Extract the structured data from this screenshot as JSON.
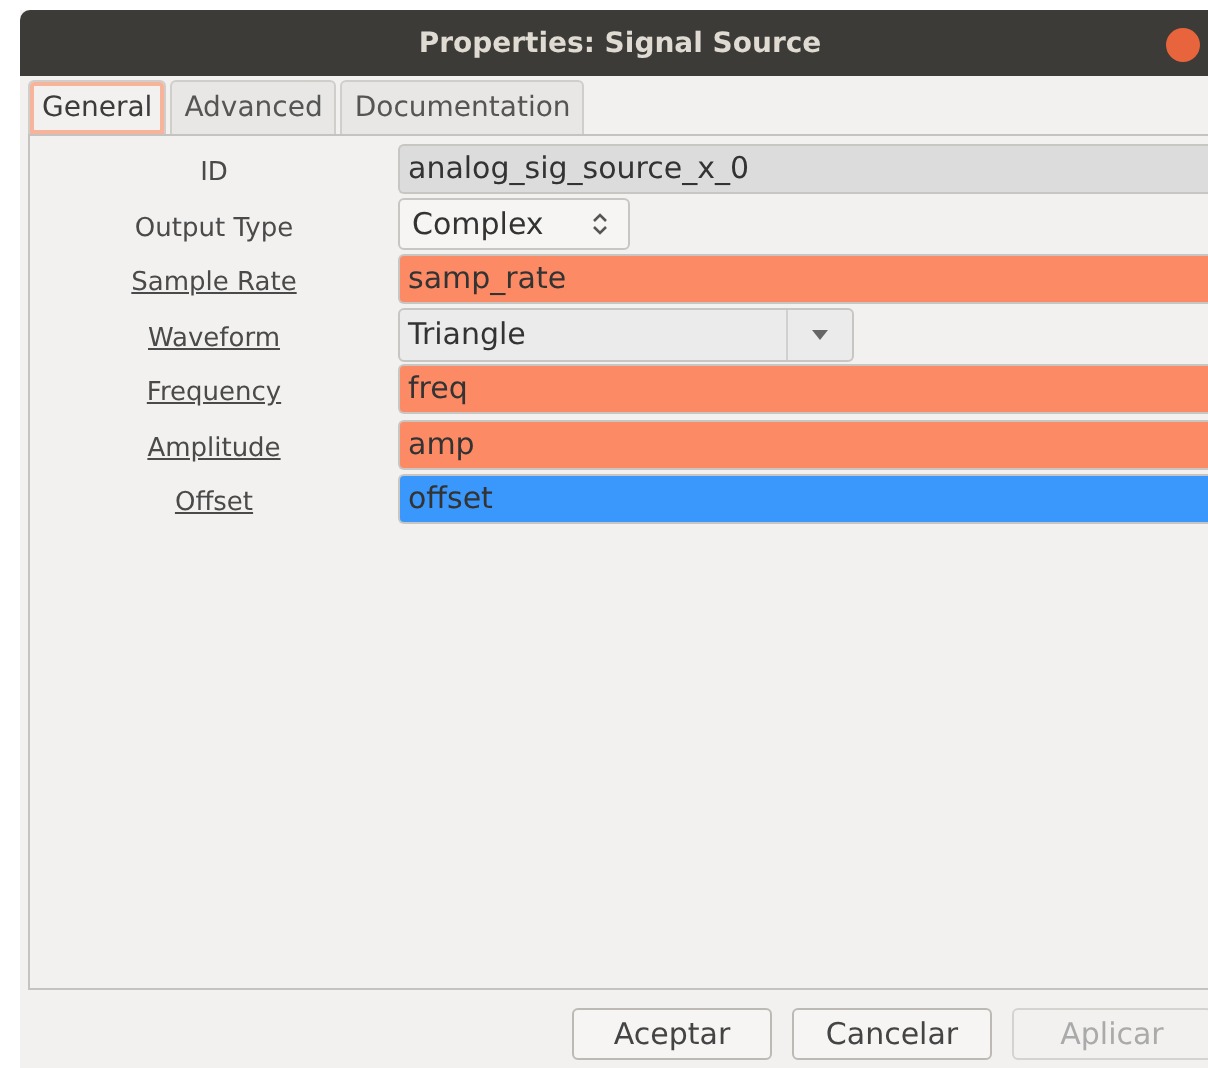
{
  "window": {
    "title": "Properties: Signal Source"
  },
  "tabs": [
    {
      "label": "General",
      "selected": true
    },
    {
      "label": "Advanced",
      "selected": false
    },
    {
      "label": "Documentation",
      "selected": false
    }
  ],
  "fields": [
    {
      "label": "ID",
      "underlined": false,
      "kind": "text",
      "value": "analog_sig_source_x_0",
      "color": "#dcdcdc"
    },
    {
      "label": "Output Type",
      "underlined": false,
      "kind": "spin",
      "value": "Complex"
    },
    {
      "label": "Sample Rate",
      "underlined": true,
      "kind": "text",
      "value": "samp_rate",
      "color": "#fc8a65"
    },
    {
      "label": "Waveform",
      "underlined": true,
      "kind": "dropdown",
      "value": "Triangle"
    },
    {
      "label": "Frequency",
      "underlined": true,
      "kind": "text",
      "value": "freq",
      "color": "#fc8a65"
    },
    {
      "label": "Amplitude",
      "underlined": true,
      "kind": "text",
      "value": "amp",
      "color": "#fc8a65"
    },
    {
      "label": "Offset",
      "underlined": true,
      "kind": "text",
      "value": "offset",
      "color": "#3a97fc"
    }
  ],
  "buttons": [
    {
      "label": "Aceptar",
      "disabled": false
    },
    {
      "label": "Cancelar",
      "disabled": false
    },
    {
      "label": "Aplicar",
      "disabled": true
    }
  ]
}
